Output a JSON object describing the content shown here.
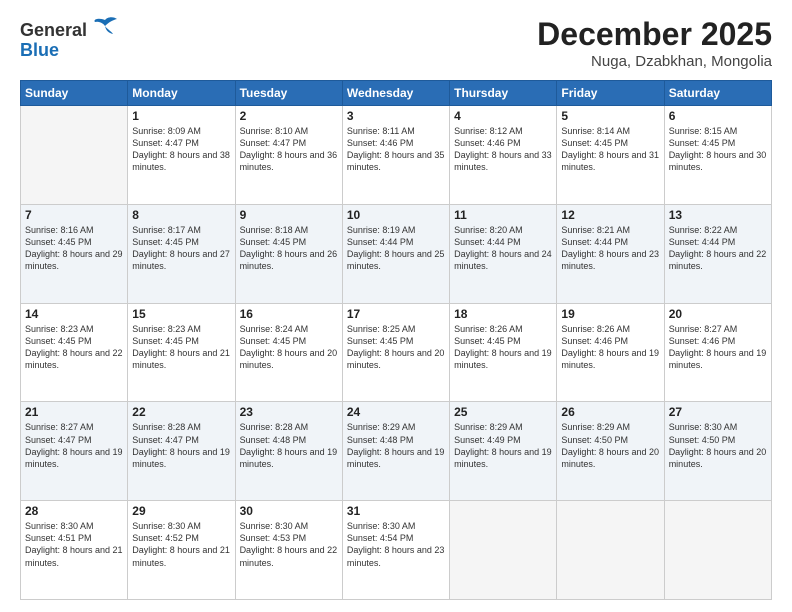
{
  "header": {
    "logo_general": "General",
    "logo_blue": "Blue",
    "month": "December 2025",
    "location": "Nuga, Dzabkhan, Mongolia"
  },
  "days_header": [
    "Sunday",
    "Monday",
    "Tuesday",
    "Wednesday",
    "Thursday",
    "Friday",
    "Saturday"
  ],
  "weeks": [
    [
      {
        "day": "",
        "sunrise": "",
        "sunset": "",
        "daylight": ""
      },
      {
        "day": "1",
        "sunrise": "Sunrise: 8:09 AM",
        "sunset": "Sunset: 4:47 PM",
        "daylight": "Daylight: 8 hours and 38 minutes."
      },
      {
        "day": "2",
        "sunrise": "Sunrise: 8:10 AM",
        "sunset": "Sunset: 4:47 PM",
        "daylight": "Daylight: 8 hours and 36 minutes."
      },
      {
        "day": "3",
        "sunrise": "Sunrise: 8:11 AM",
        "sunset": "Sunset: 4:46 PM",
        "daylight": "Daylight: 8 hours and 35 minutes."
      },
      {
        "day": "4",
        "sunrise": "Sunrise: 8:12 AM",
        "sunset": "Sunset: 4:46 PM",
        "daylight": "Daylight: 8 hours and 33 minutes."
      },
      {
        "day": "5",
        "sunrise": "Sunrise: 8:14 AM",
        "sunset": "Sunset: 4:45 PM",
        "daylight": "Daylight: 8 hours and 31 minutes."
      },
      {
        "day": "6",
        "sunrise": "Sunrise: 8:15 AM",
        "sunset": "Sunset: 4:45 PM",
        "daylight": "Daylight: 8 hours and 30 minutes."
      }
    ],
    [
      {
        "day": "7",
        "sunrise": "Sunrise: 8:16 AM",
        "sunset": "Sunset: 4:45 PM",
        "daylight": "Daylight: 8 hours and 29 minutes."
      },
      {
        "day": "8",
        "sunrise": "Sunrise: 8:17 AM",
        "sunset": "Sunset: 4:45 PM",
        "daylight": "Daylight: 8 hours and 27 minutes."
      },
      {
        "day": "9",
        "sunrise": "Sunrise: 8:18 AM",
        "sunset": "Sunset: 4:45 PM",
        "daylight": "Daylight: 8 hours and 26 minutes."
      },
      {
        "day": "10",
        "sunrise": "Sunrise: 8:19 AM",
        "sunset": "Sunset: 4:44 PM",
        "daylight": "Daylight: 8 hours and 25 minutes."
      },
      {
        "day": "11",
        "sunrise": "Sunrise: 8:20 AM",
        "sunset": "Sunset: 4:44 PM",
        "daylight": "Daylight: 8 hours and 24 minutes."
      },
      {
        "day": "12",
        "sunrise": "Sunrise: 8:21 AM",
        "sunset": "Sunset: 4:44 PM",
        "daylight": "Daylight: 8 hours and 23 minutes."
      },
      {
        "day": "13",
        "sunrise": "Sunrise: 8:22 AM",
        "sunset": "Sunset: 4:44 PM",
        "daylight": "Daylight: 8 hours and 22 minutes."
      }
    ],
    [
      {
        "day": "14",
        "sunrise": "Sunrise: 8:23 AM",
        "sunset": "Sunset: 4:45 PM",
        "daylight": "Daylight: 8 hours and 22 minutes."
      },
      {
        "day": "15",
        "sunrise": "Sunrise: 8:23 AM",
        "sunset": "Sunset: 4:45 PM",
        "daylight": "Daylight: 8 hours and 21 minutes."
      },
      {
        "day": "16",
        "sunrise": "Sunrise: 8:24 AM",
        "sunset": "Sunset: 4:45 PM",
        "daylight": "Daylight: 8 hours and 20 minutes."
      },
      {
        "day": "17",
        "sunrise": "Sunrise: 8:25 AM",
        "sunset": "Sunset: 4:45 PM",
        "daylight": "Daylight: 8 hours and 20 minutes."
      },
      {
        "day": "18",
        "sunrise": "Sunrise: 8:26 AM",
        "sunset": "Sunset: 4:45 PM",
        "daylight": "Daylight: 8 hours and 19 minutes."
      },
      {
        "day": "19",
        "sunrise": "Sunrise: 8:26 AM",
        "sunset": "Sunset: 4:46 PM",
        "daylight": "Daylight: 8 hours and 19 minutes."
      },
      {
        "day": "20",
        "sunrise": "Sunrise: 8:27 AM",
        "sunset": "Sunset: 4:46 PM",
        "daylight": "Daylight: 8 hours and 19 minutes."
      }
    ],
    [
      {
        "day": "21",
        "sunrise": "Sunrise: 8:27 AM",
        "sunset": "Sunset: 4:47 PM",
        "daylight": "Daylight: 8 hours and 19 minutes."
      },
      {
        "day": "22",
        "sunrise": "Sunrise: 8:28 AM",
        "sunset": "Sunset: 4:47 PM",
        "daylight": "Daylight: 8 hours and 19 minutes."
      },
      {
        "day": "23",
        "sunrise": "Sunrise: 8:28 AM",
        "sunset": "Sunset: 4:48 PM",
        "daylight": "Daylight: 8 hours and 19 minutes."
      },
      {
        "day": "24",
        "sunrise": "Sunrise: 8:29 AM",
        "sunset": "Sunset: 4:48 PM",
        "daylight": "Daylight: 8 hours and 19 minutes."
      },
      {
        "day": "25",
        "sunrise": "Sunrise: 8:29 AM",
        "sunset": "Sunset: 4:49 PM",
        "daylight": "Daylight: 8 hours and 19 minutes."
      },
      {
        "day": "26",
        "sunrise": "Sunrise: 8:29 AM",
        "sunset": "Sunset: 4:50 PM",
        "daylight": "Daylight: 8 hours and 20 minutes."
      },
      {
        "day": "27",
        "sunrise": "Sunrise: 8:30 AM",
        "sunset": "Sunset: 4:50 PM",
        "daylight": "Daylight: 8 hours and 20 minutes."
      }
    ],
    [
      {
        "day": "28",
        "sunrise": "Sunrise: 8:30 AM",
        "sunset": "Sunset: 4:51 PM",
        "daylight": "Daylight: 8 hours and 21 minutes."
      },
      {
        "day": "29",
        "sunrise": "Sunrise: 8:30 AM",
        "sunset": "Sunset: 4:52 PM",
        "daylight": "Daylight: 8 hours and 21 minutes."
      },
      {
        "day": "30",
        "sunrise": "Sunrise: 8:30 AM",
        "sunset": "Sunset: 4:53 PM",
        "daylight": "Daylight: 8 hours and 22 minutes."
      },
      {
        "day": "31",
        "sunrise": "Sunrise: 8:30 AM",
        "sunset": "Sunset: 4:54 PM",
        "daylight": "Daylight: 8 hours and 23 minutes."
      },
      {
        "day": "",
        "sunrise": "",
        "sunset": "",
        "daylight": ""
      },
      {
        "day": "",
        "sunrise": "",
        "sunset": "",
        "daylight": ""
      },
      {
        "day": "",
        "sunrise": "",
        "sunset": "",
        "daylight": ""
      }
    ]
  ]
}
